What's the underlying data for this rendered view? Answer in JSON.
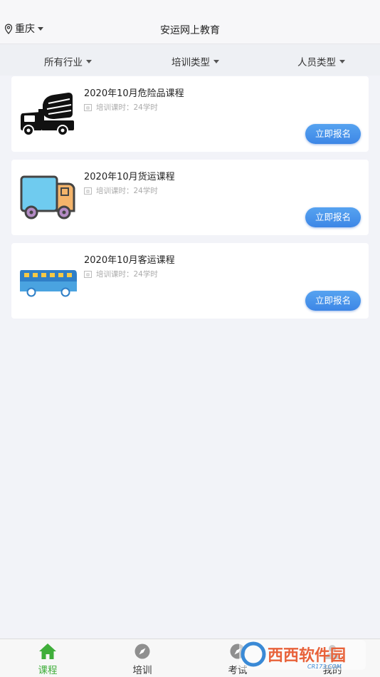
{
  "header": {
    "location": "重庆",
    "title": "安运网上教育"
  },
  "filters": [
    {
      "label": "所有行业"
    },
    {
      "label": "培训类型"
    },
    {
      "label": "人员类型"
    }
  ],
  "courses": [
    {
      "name": "2020年10月危险品课程",
      "meta": "培训课时：24学时",
      "button": "立即报名",
      "icon": "mixer-truck-icon"
    },
    {
      "name": "2020年10月货运课程",
      "meta": "培训课时：24学时",
      "button": "立即报名",
      "icon": "cargo-truck-icon"
    },
    {
      "name": "2020年10月客运课程",
      "meta": "培训课时：24学时",
      "button": "立即报名",
      "icon": "bus-icon"
    }
  ],
  "tabbar": {
    "active_color": "#3fae3a",
    "items": [
      {
        "label": "课程",
        "icon": "home-icon",
        "active": true
      },
      {
        "label": "培训",
        "icon": "compass-icon",
        "active": false
      },
      {
        "label": "考试",
        "icon": "compass-icon",
        "active": false
      },
      {
        "label": "我的",
        "icon": "user-icon",
        "active": false
      }
    ]
  },
  "watermark": {
    "text": "西西软件园",
    "subtext": "CR173.COM"
  }
}
